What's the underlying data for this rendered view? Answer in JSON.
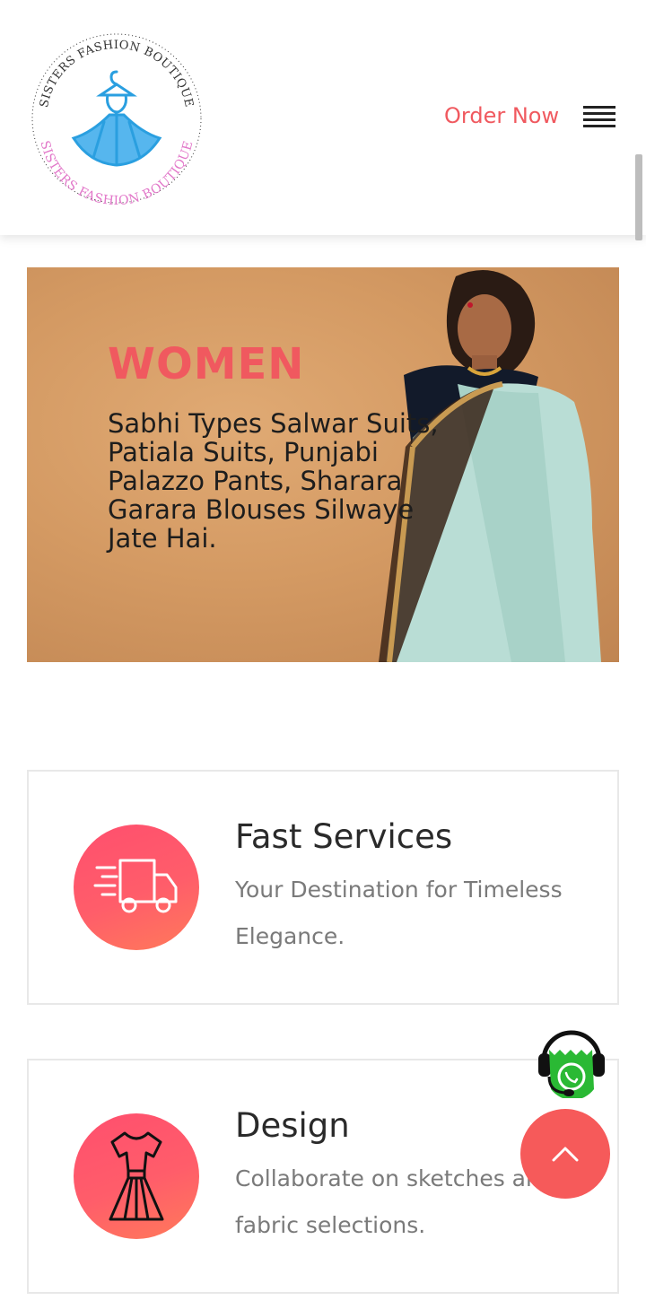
{
  "header": {
    "logo": {
      "top_text": "SISTERS FASHION BOUTIQUE",
      "bottom_text": "SISTERS FASHION BOUTIQUE"
    },
    "order_label": "Order Now",
    "menu_icon": "hamburger-icon"
  },
  "banner": {
    "heading": "WOMEN",
    "text": "Sabhi Types Salwar Suits, Patiala Suits, Punjabi Palazzo Pants, Sharara Garara Blouses Silwaye Jate Hai."
  },
  "features": [
    {
      "title": "Fast Services",
      "description": "Your Destination for Timeless Elegance.",
      "icon": "delivery-truck-icon"
    },
    {
      "title": "Design",
      "description": "Collaborate on sketches and fabric selections.",
      "icon": "dress-icon"
    }
  ],
  "floating": {
    "whatsapp_icon": "whatsapp-support-icon",
    "scroll_top_icon": "chevron-up-icon"
  },
  "colors": {
    "accent": "#f0595f",
    "circle_gradient_start": "#ff4f6e",
    "circle_gradient_end": "#ff7a5a",
    "scroll_top_bg": "#f65a5a",
    "whatsapp_green": "#2ab934"
  }
}
